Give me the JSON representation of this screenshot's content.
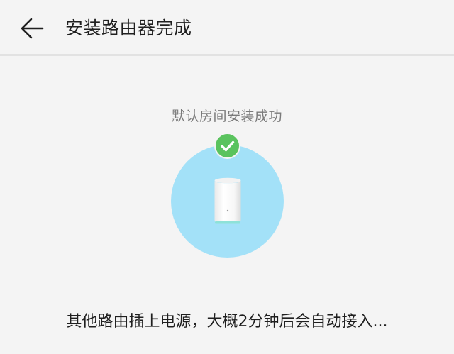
{
  "header": {
    "title": "安装路由器完成",
    "back_icon": "arrow-left-icon"
  },
  "status": {
    "text": "默认房间安装成功",
    "check_icon": "checkmark-icon",
    "check_color": "#5ac35e",
    "circle_color": "#a3e1f8"
  },
  "device": {
    "icon": "router-icon"
  },
  "message": {
    "text": "其他路由插上电源，大概2分钟后会自动接入..."
  }
}
